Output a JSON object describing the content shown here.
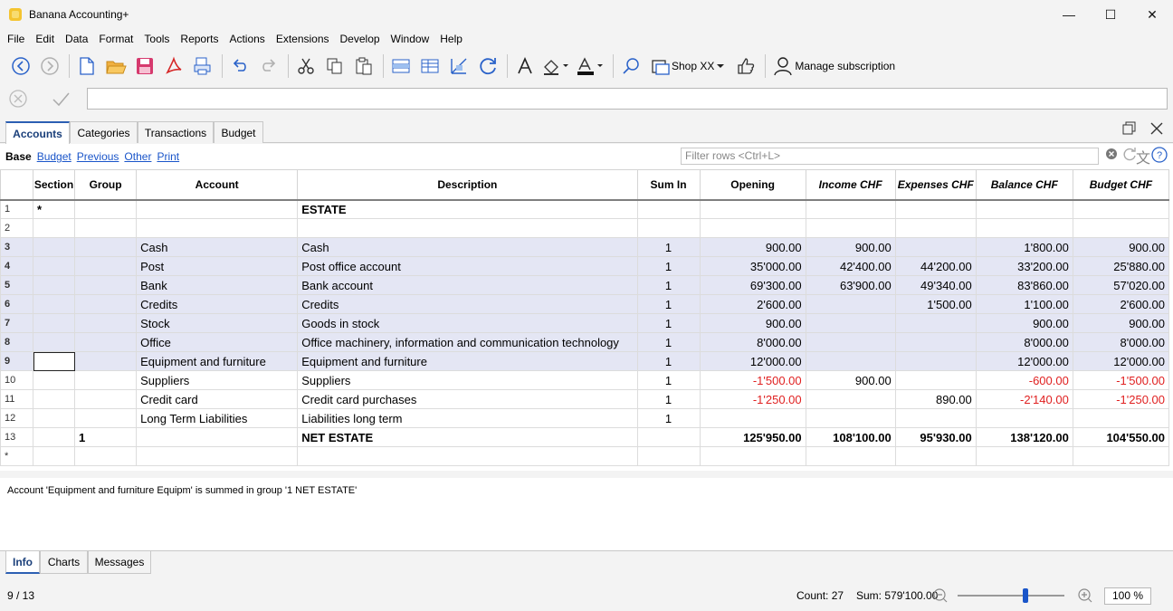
{
  "window": {
    "title": "Banana Accounting+",
    "controls": {
      "minimize": "—",
      "maximize": "☐",
      "close": "✕"
    }
  },
  "menu": [
    "File",
    "Edit",
    "Data",
    "Format",
    "Tools",
    "Reports",
    "Actions",
    "Extensions",
    "Develop",
    "Window",
    "Help"
  ],
  "toolbar": {
    "shop_label": "Shop XX",
    "manage_label": "Manage subscription",
    "icons": [
      "back-icon",
      "forward-icon",
      "new-file-icon",
      "open-folder-icon",
      "save-icon",
      "pdf-icon",
      "print-preview-icon",
      "undo-icon",
      "redo-icon",
      "cut-icon",
      "copy-icon",
      "paste-icon",
      "add-row-icon",
      "insert-row-icon",
      "columns-icon",
      "refresh-icon",
      "font-icon",
      "fill-color-icon",
      "text-color-icon",
      "search-icon",
      "shop-icon",
      "thumbs-up-icon",
      "user-icon"
    ]
  },
  "doc_tabs": [
    "Accounts",
    "Categories",
    "Transactions",
    "Budget"
  ],
  "view_links": [
    "Base",
    "Budget",
    "Previous",
    "Other",
    "Print"
  ],
  "filter": {
    "placeholder": "Filter rows <Ctrl+L>"
  },
  "columns": [
    "Section",
    "Group",
    "Account",
    "Description",
    "Sum In",
    "Opening",
    "Income CHF",
    "Expenses CHF",
    "Balance CHF",
    "Budget CHF"
  ],
  "rows": [
    {
      "n": "1",
      "section": "*",
      "group": "",
      "account": "",
      "description": "ESTATE",
      "sumin": "",
      "opening": "",
      "income": "",
      "expenses": "",
      "balance": "",
      "budget": ""
    },
    {
      "n": "2",
      "section": "",
      "group": "",
      "account": "",
      "description": "",
      "sumin": "",
      "opening": "",
      "income": "",
      "expenses": "",
      "balance": "",
      "budget": ""
    },
    {
      "n": "3",
      "section": "",
      "group": "",
      "account": "Cash",
      "description": "Cash",
      "sumin": "1",
      "opening": "900.00",
      "income": "900.00",
      "expenses": "",
      "balance": "1'800.00",
      "budget": "900.00"
    },
    {
      "n": "4",
      "section": "",
      "group": "",
      "account": "Post",
      "description": "Post office account",
      "sumin": "1",
      "opening": "35'000.00",
      "income": "42'400.00",
      "expenses": "44'200.00",
      "balance": "33'200.00",
      "budget": "25'880.00"
    },
    {
      "n": "5",
      "section": "",
      "group": "",
      "account": "Bank",
      "description": "Bank account",
      "sumin": "1",
      "opening": "69'300.00",
      "income": "63'900.00",
      "expenses": "49'340.00",
      "balance": "83'860.00",
      "budget": "57'020.00"
    },
    {
      "n": "6",
      "section": "",
      "group": "",
      "account": "Credits",
      "description": "Credits",
      "sumin": "1",
      "opening": "2'600.00",
      "income": "",
      "expenses": "1'500.00",
      "balance": "1'100.00",
      "budget": "2'600.00"
    },
    {
      "n": "7",
      "section": "",
      "group": "",
      "account": "Stock",
      "description": "Goods in stock",
      "sumin": "1",
      "opening": "900.00",
      "income": "",
      "expenses": "",
      "balance": "900.00",
      "budget": "900.00"
    },
    {
      "n": "8",
      "section": "",
      "group": "",
      "account": "Office",
      "description": "Office machinery, information and communication technology",
      "sumin": "1",
      "opening": "8'000.00",
      "income": "",
      "expenses": "",
      "balance": "8'000.00",
      "budget": "8'000.00"
    },
    {
      "n": "9",
      "section": "",
      "group": "",
      "account": "Equipment and furniture",
      "description": "Equipment and furniture",
      "sumin": "1",
      "opening": "12'000.00",
      "income": "",
      "expenses": "",
      "balance": "12'000.00",
      "budget": "12'000.00"
    },
    {
      "n": "10",
      "section": "",
      "group": "",
      "account": "Suppliers",
      "description": "Suppliers",
      "sumin": "1",
      "opening": "-1'500.00",
      "income": "900.00",
      "expenses": "",
      "balance": "-600.00",
      "budget": "-1'500.00"
    },
    {
      "n": "11",
      "section": "",
      "group": "",
      "account": "Credit card",
      "description": "Credit card purchases",
      "sumin": "1",
      "opening": "-1'250.00",
      "income": "",
      "expenses": "890.00",
      "balance": "-2'140.00",
      "budget": "-1'250.00"
    },
    {
      "n": "12",
      "section": "",
      "group": "",
      "account": "Long Term Liabilities",
      "description": "Liabilities long term",
      "sumin": "1",
      "opening": "",
      "income": "",
      "expenses": "",
      "balance": "",
      "budget": ""
    },
    {
      "n": "13",
      "section": "",
      "group": "1",
      "account": "",
      "description": "NET ESTATE",
      "sumin": "",
      "opening": "125'950.00",
      "income": "108'100.00",
      "expenses": "95'930.00",
      "balance": "138'120.00",
      "budget": "104'550.00"
    },
    {
      "n": "*",
      "section": "",
      "group": "",
      "account": "",
      "description": "",
      "sumin": "",
      "opening": "",
      "income": "",
      "expenses": "",
      "balance": "",
      "budget": ""
    }
  ],
  "info_message": "Account 'Equipment and furniture Equipm' is summed in group '1 NET ESTATE'",
  "info_tabs": [
    "Info",
    "Charts",
    "Messages"
  ],
  "status": {
    "position": "9 / 13",
    "count": "Count: 27",
    "sum": "Sum: 579'100.00",
    "zoom": "100 %"
  }
}
